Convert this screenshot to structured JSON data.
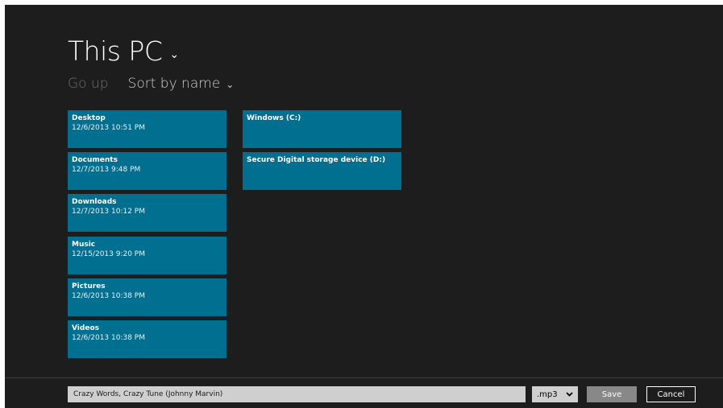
{
  "header": {
    "location": "This PC",
    "location_chevron": "⌄",
    "go_up": "Go up",
    "sort": "Sort by name",
    "sort_chevron": "⌄"
  },
  "folders": [
    {
      "name": "Desktop",
      "date": "12/6/2013 10:51 PM"
    },
    {
      "name": "Documents",
      "date": "12/7/2013 9:48 PM"
    },
    {
      "name": "Downloads",
      "date": "12/7/2013 10:12 PM"
    },
    {
      "name": "Music",
      "date": "12/15/2013 9:20 PM"
    },
    {
      "name": "Pictures",
      "date": "12/6/2013 10:38 PM"
    },
    {
      "name": "Videos",
      "date": "12/6/2013 10:38 PM"
    }
  ],
  "drives": [
    {
      "name": "Windows (C:)"
    },
    {
      "name": "Secure Digital storage device (D:)"
    }
  ],
  "bottom": {
    "filename_value": "Crazy Words, Crazy Tune (Johnny Marvin)",
    "extension": ".mp3",
    "extension_chevron": "⌄",
    "save_label": "Save",
    "cancel_label": "Cancel"
  },
  "colors": {
    "background": "#1d1d1d",
    "tile": "#006f90",
    "input": "#cfcfcf"
  }
}
